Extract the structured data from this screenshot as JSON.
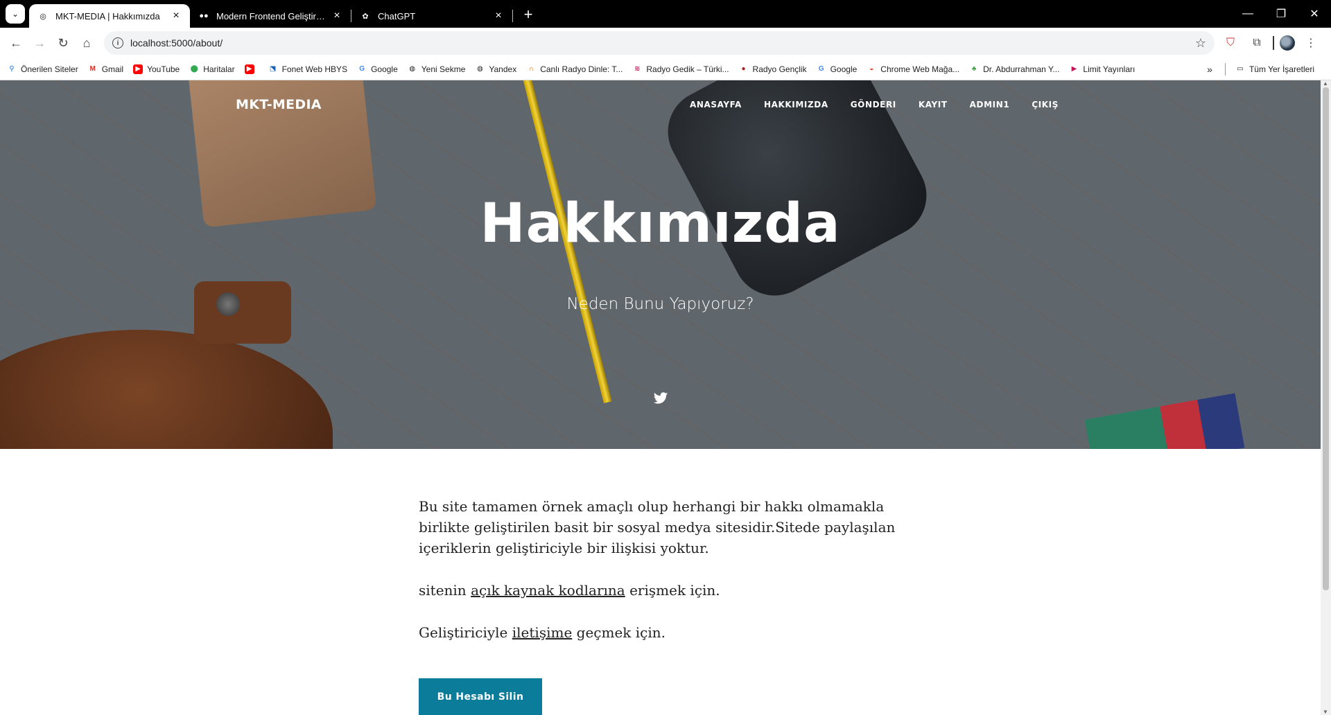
{
  "browser": {
    "tabs": [
      {
        "title": "MKT-MEDIA | Hakkımızda",
        "active": true
      },
      {
        "title": "Modern Frontend Geliştirme: H",
        "active": false
      },
      {
        "title": "ChatGPT",
        "active": false
      }
    ],
    "url": "localhost:5000/about/",
    "bookmarks": [
      "Önerilen Siteler",
      "Gmail",
      "YouTube",
      "Haritalar",
      "",
      "Fonet Web HBYS",
      "Google",
      "Yeni Sekme",
      "Yandex",
      "Canlı Radyo Dinle: T...",
      "Radyo Gedik – Türki...",
      "Radyo Gençlik",
      "Google",
      "Chrome Web Mağa...",
      "Dr. Abdurrahman Y...",
      "Limit Yayınları"
    ],
    "all_bookmarks": "Tüm Yer İşaretleri"
  },
  "site": {
    "brand": "MKT-MEDIA",
    "nav": [
      "ANASAYFA",
      "HAKKIMIZDA",
      "GÖNDERI",
      "KAYIT",
      "ADMIN1",
      "ÇIKIŞ"
    ],
    "hero_title": "Hakkımızda",
    "hero_subtitle": "Neden Bunu Yapıyoruz?",
    "intro": "Bu site tamamen örnek amaçlı olup herhangi bir hakkı olmamakla birlikte geliştirilen basit bir sosyal medya sitesidir.Sitede paylaşılan içeriklerin geliştiriciyle bir ilişkisi yoktur.",
    "source_prefix": "sitenin ",
    "source_link": "açık kaynak kodlarına",
    "source_suffix": " erişmek için.",
    "contact_prefix": "Geliştiriciyle ",
    "contact_link": "iletişime",
    "contact_suffix": " geçmek için.",
    "delete_button": "Bu Hesabı Silin"
  }
}
